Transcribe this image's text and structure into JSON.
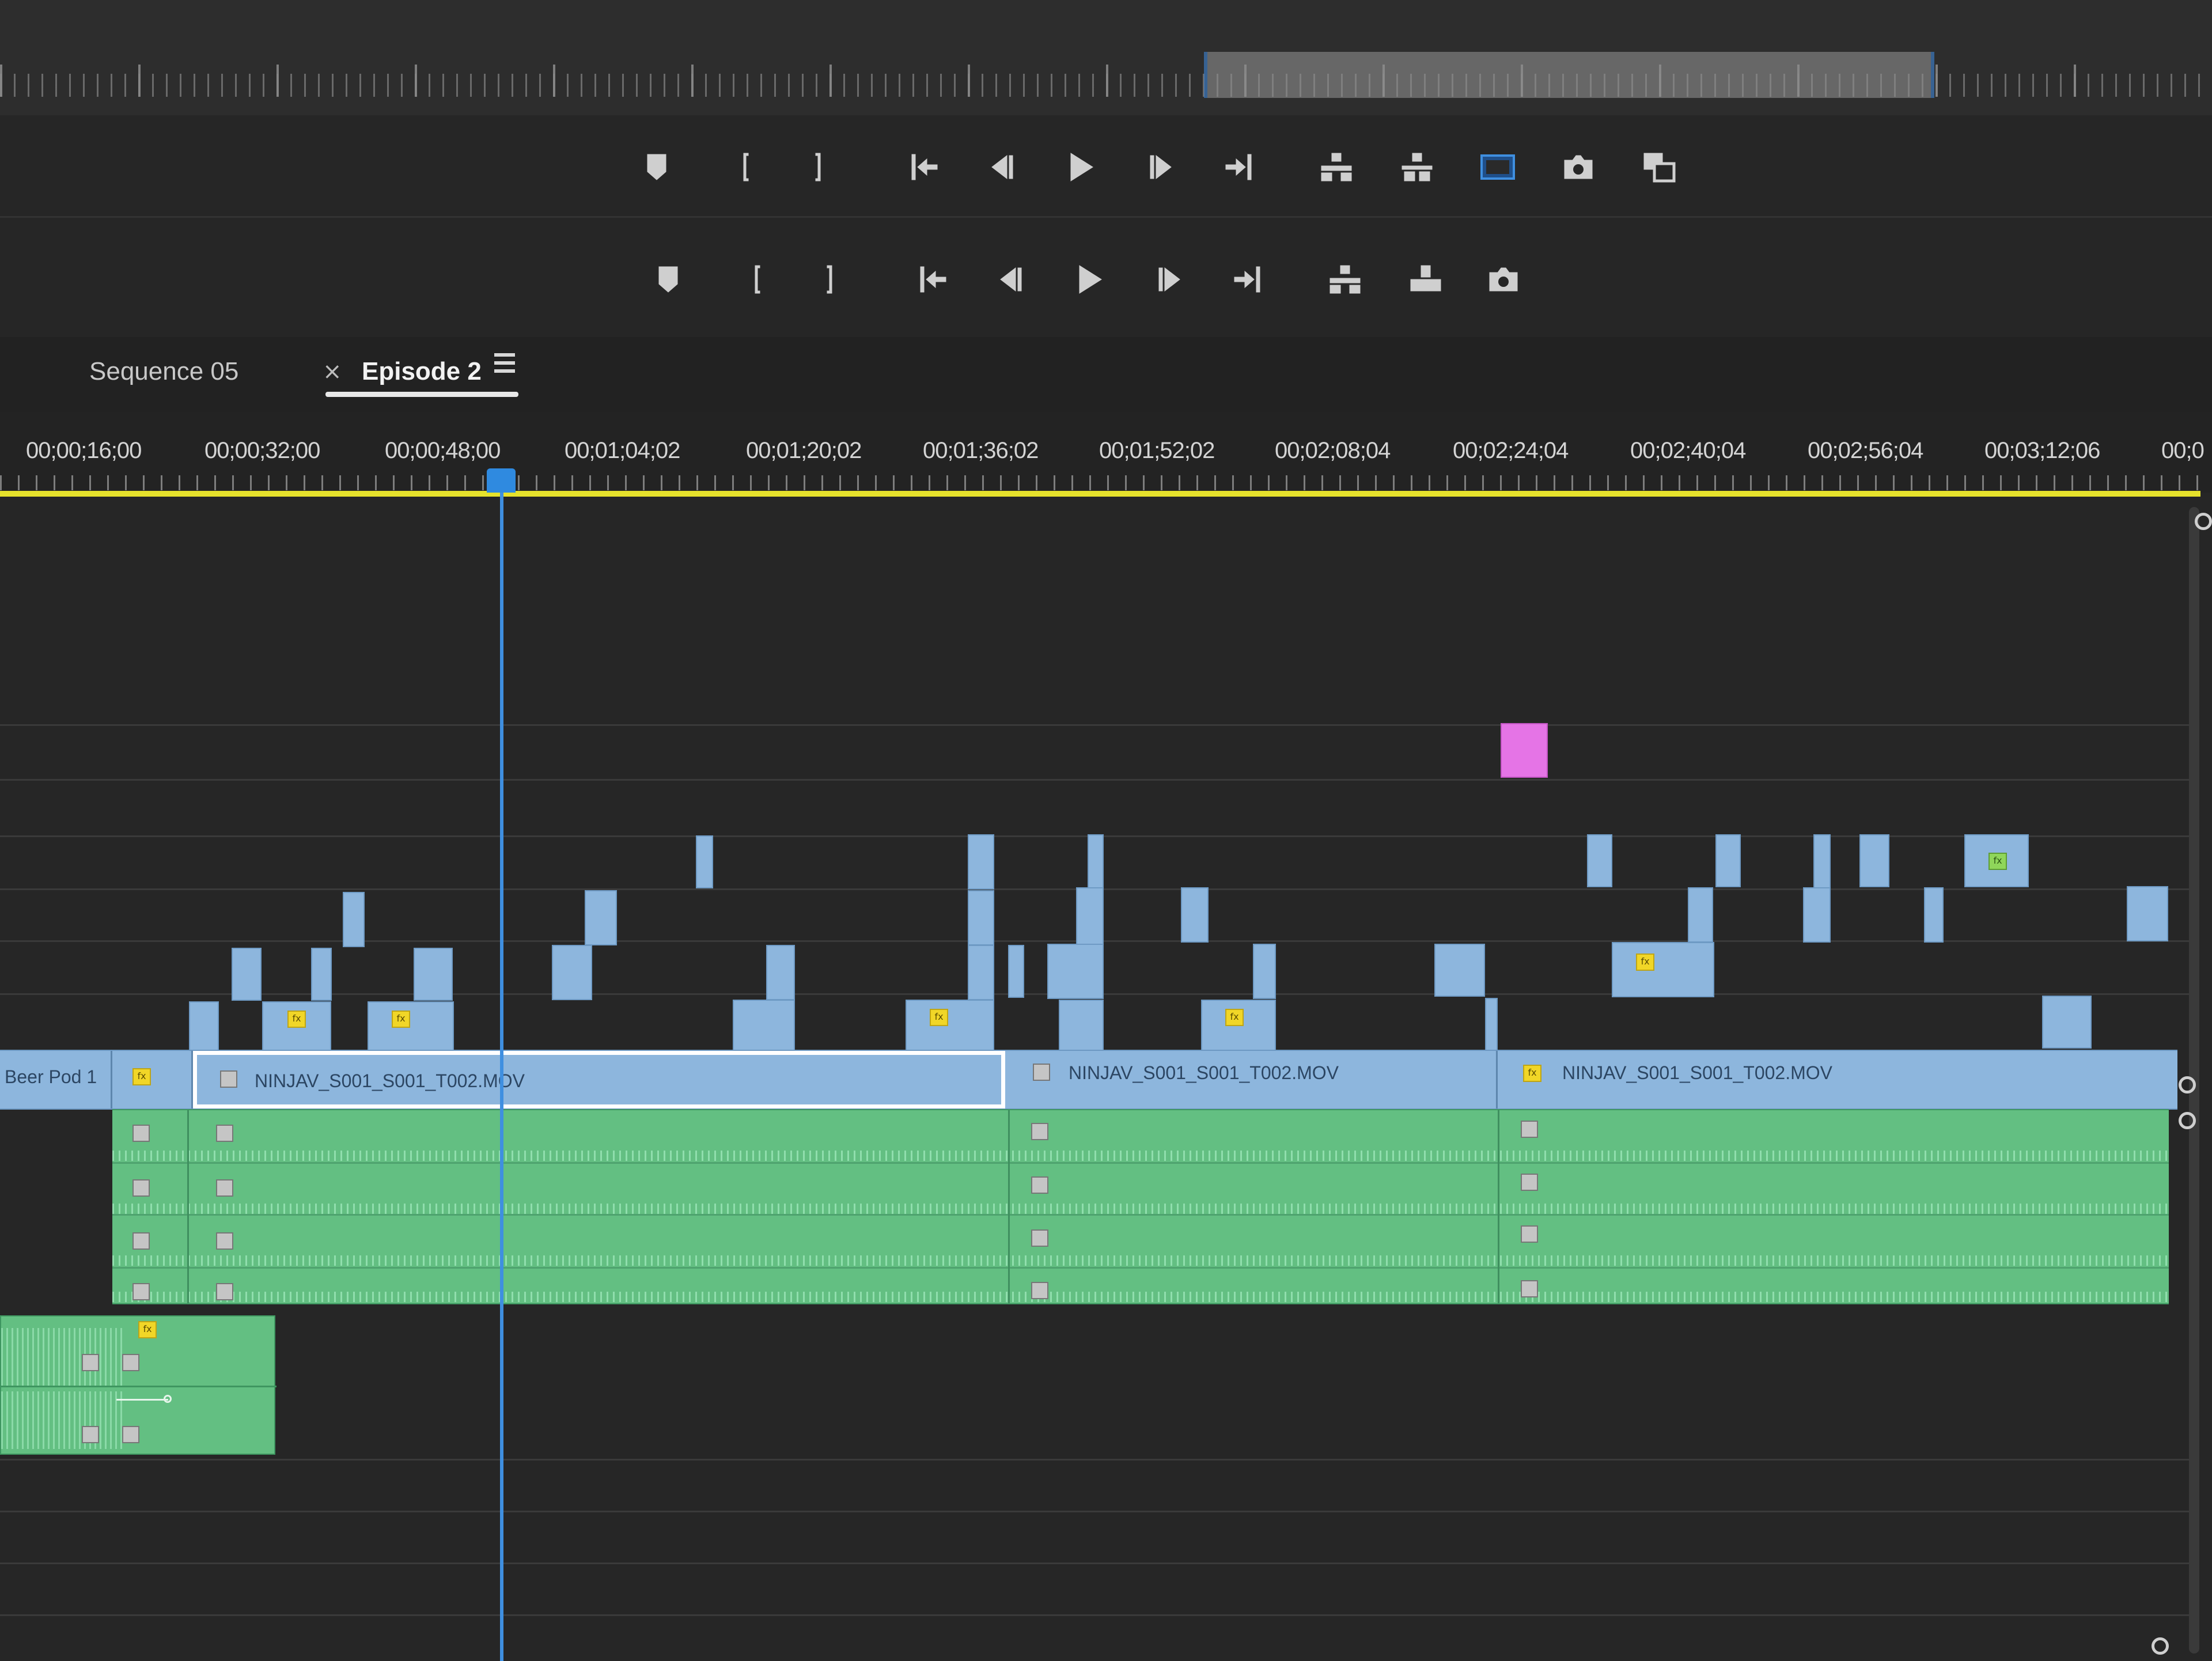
{
  "tabs": {
    "sequence_05": "Sequence 05",
    "episode_2": "Episode 2",
    "close_glyph": "×"
  },
  "ruler": {
    "timecodes": [
      "00;00;16;00",
      "00;00;32;00",
      "00;00;48;00",
      "00;01;04;02",
      "00;01;20;02",
      "00;01;36;02",
      "00;01;52;02",
      "00;02;08;04",
      "00;02;24;04",
      "00;02;40;04",
      "00;02;56;04",
      "00;03;12;06",
      "00;0"
    ]
  },
  "transport_top": [
    "add-marker-icon",
    "mark-in-icon",
    "mark-out-icon",
    "go-to-in-icon",
    "step-back-icon",
    "play-icon",
    "step-forward-icon",
    "go-to-out-icon",
    "lift-icon",
    "extract-icon",
    "comparison-view-icon",
    "export-frame-icon",
    "multi-camera-icon"
  ],
  "transport_bottom": [
    "add-marker-icon",
    "mark-in-icon",
    "mark-out-icon",
    "go-to-in-icon",
    "step-back-icon",
    "play-icon",
    "step-forward-icon",
    "go-to-out-icon",
    "insert-icon",
    "overwrite-icon",
    "export-frame-icon"
  ],
  "v1_clips": {
    "first_label": "Beer Pod 1",
    "clip_1": "NINJAV_S001_S001_T002.MOV",
    "clip_2": "NINJAV_S001_S001_T002.MOV",
    "clip_3": "NINJAV_S001_S001_T002.MOV"
  },
  "fx_badge": "fx",
  "colors": {
    "video_clip": "#8db6dd",
    "audio_clip": "#63bf82",
    "work_area": "#e6e22c",
    "playhead": "#3f8fe0",
    "marker_clip": "#e574e6",
    "fx_badge": "#f1d627"
  }
}
